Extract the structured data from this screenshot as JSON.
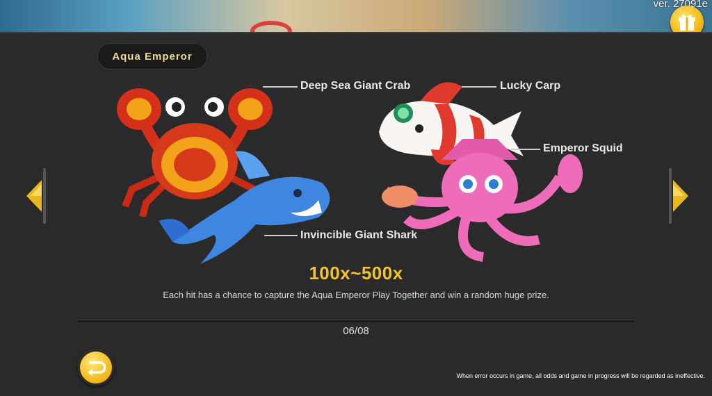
{
  "header": {
    "version": "ver. 27091e"
  },
  "panel": {
    "title": "Aqua Emperor"
  },
  "creatures": {
    "crab": "Deep Sea Giant Crab",
    "shark": "Invincible Giant Shark",
    "carp": "Lucky Carp",
    "squid": "Emperor Squid"
  },
  "reward": {
    "multiplier": "100x~500x",
    "description": "Each hit has a chance to capture the Aqua Emperor Play Together and win a random huge prize."
  },
  "pagination": {
    "indicator": "06/08",
    "current": 6,
    "total": 8
  },
  "footer": {
    "disclaimer": "When error occurs in game, all odds and game in progress will be regarded as ineffective."
  },
  "icons": {
    "gift": "gift-icon",
    "back": "return-arrow-icon",
    "prev": "triangle-left-icon",
    "next": "triangle-right-icon"
  },
  "colors": {
    "accent_gold": "#f2c230",
    "title_text": "#f0d79a",
    "panel_bg": "#2a2a2a"
  }
}
